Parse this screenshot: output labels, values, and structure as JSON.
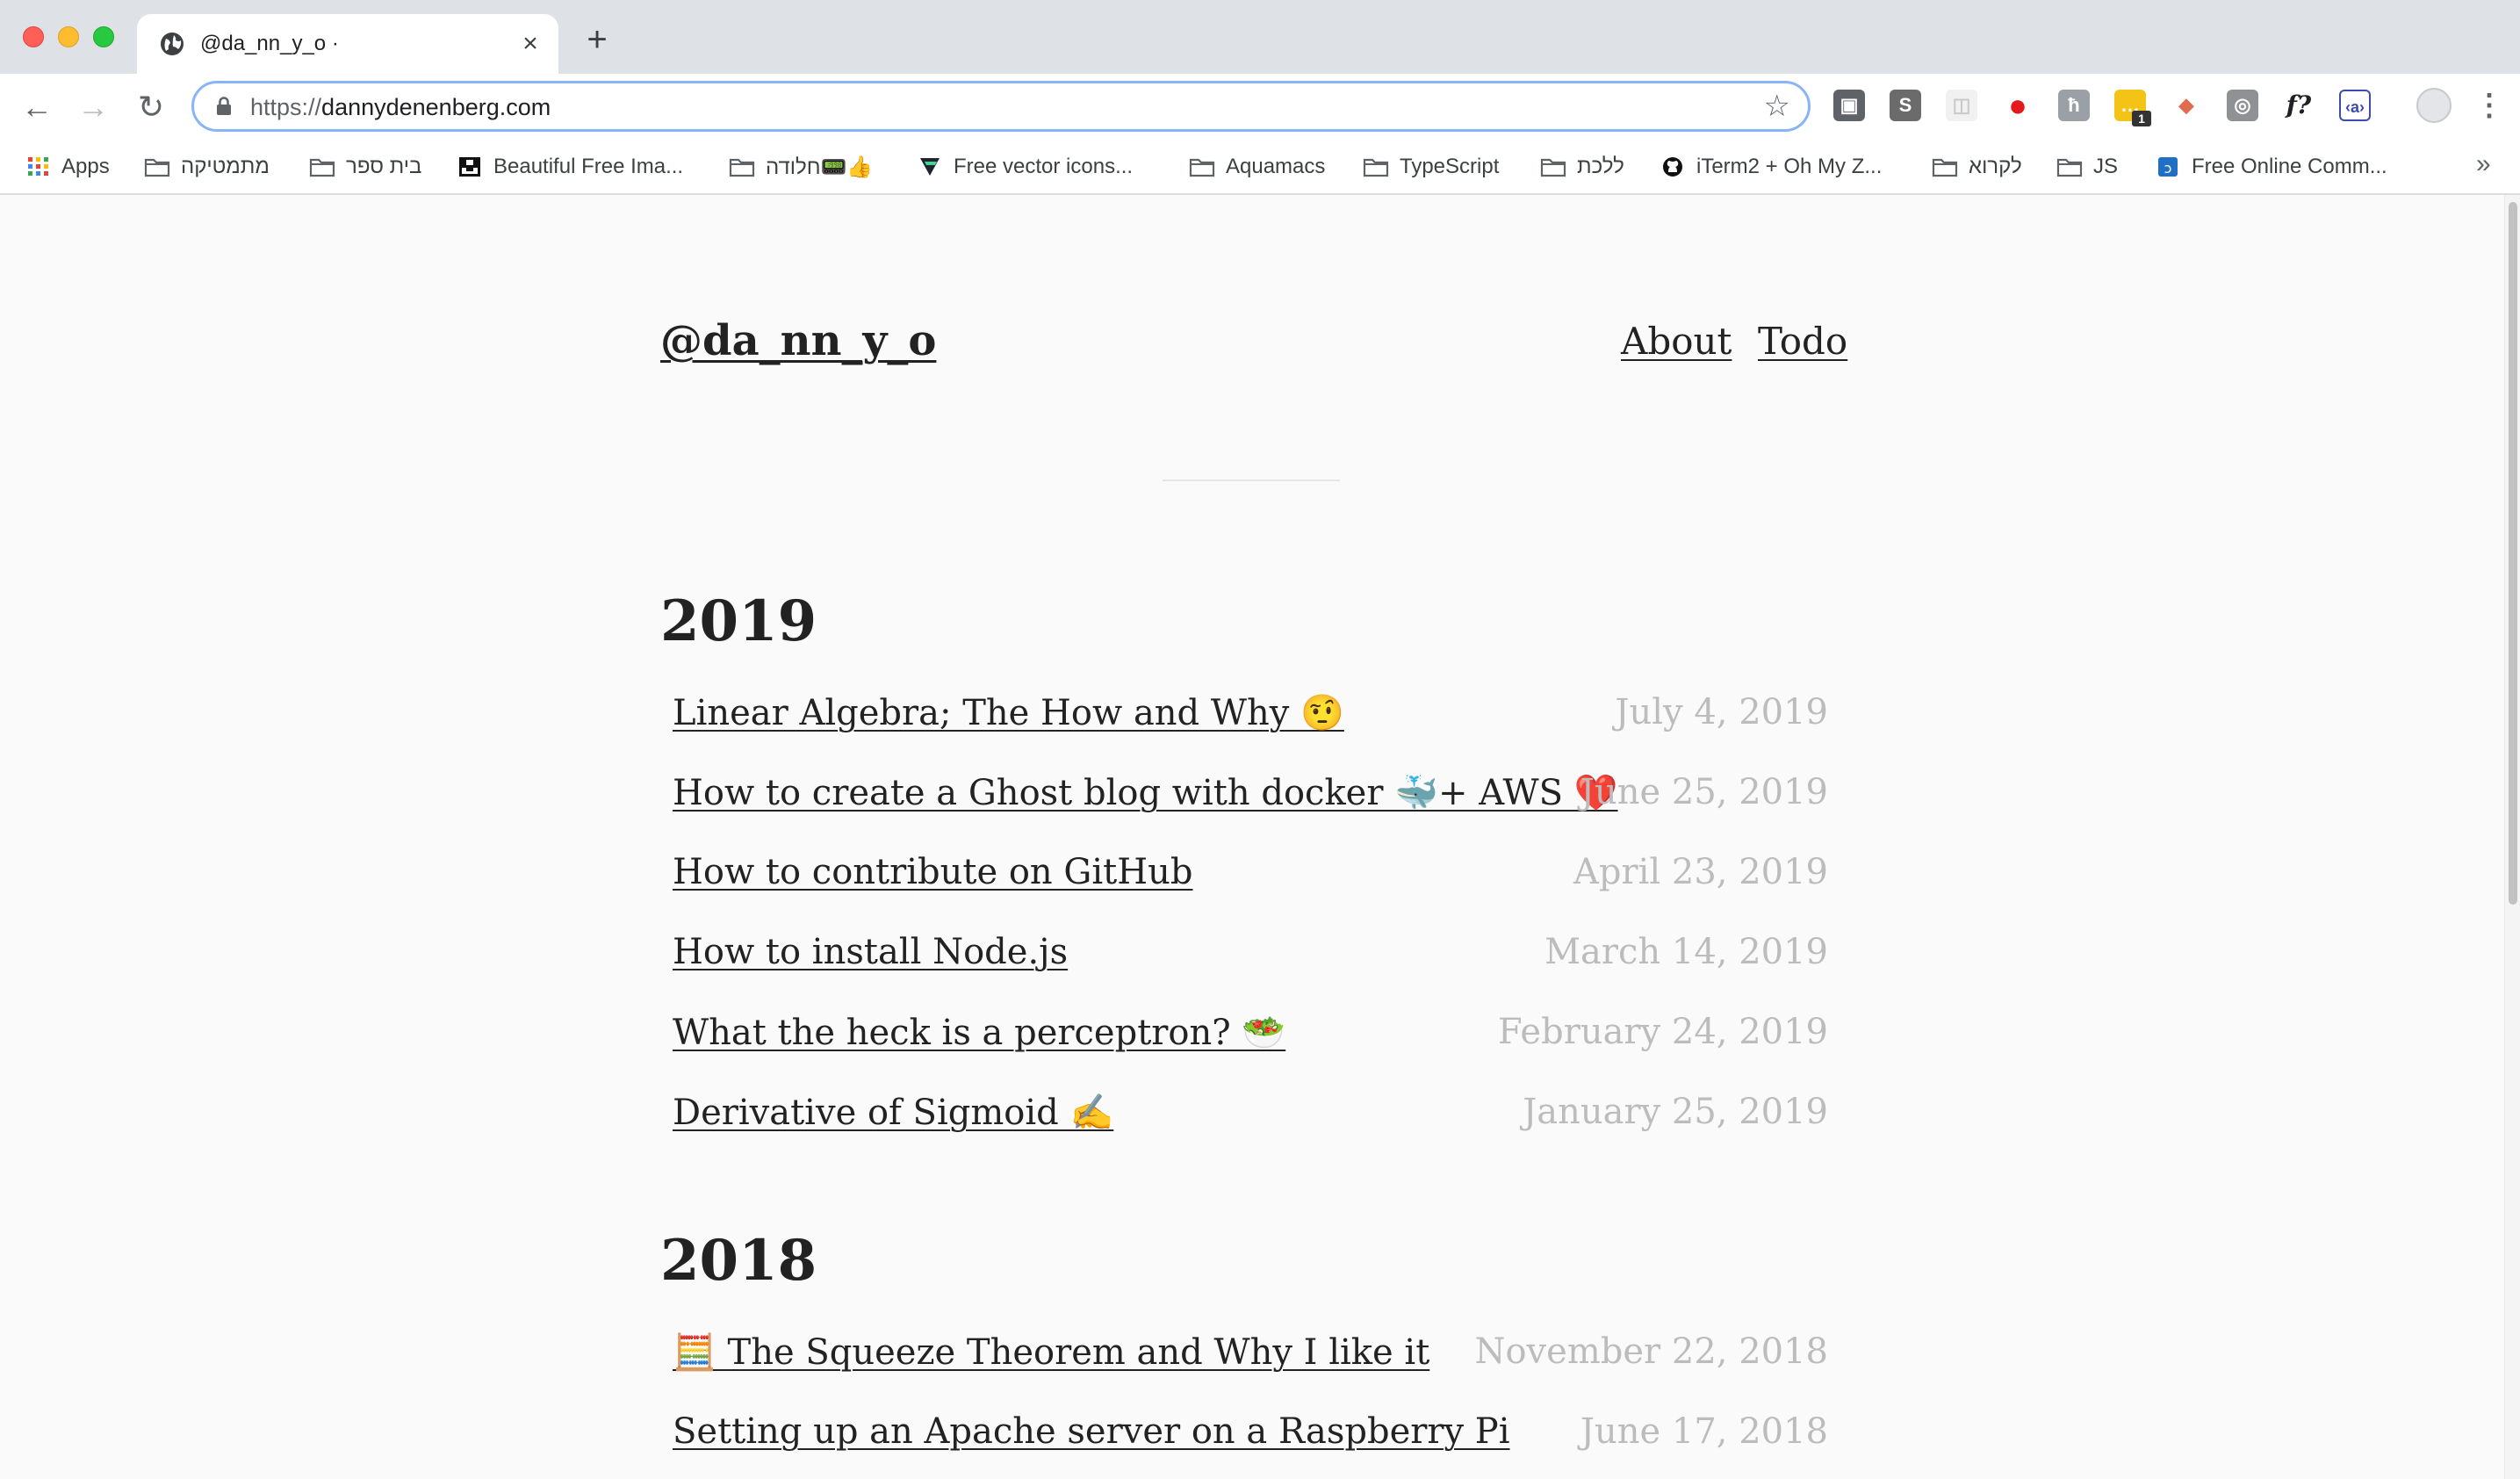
{
  "browser": {
    "tab": {
      "title": "@da_nn_y_o ·",
      "close_glyph": "×"
    },
    "new_tab_glyph": "+",
    "nav": {
      "back_glyph": "←",
      "forward_glyph": "→",
      "reload_glyph": "↻"
    },
    "url": {
      "scheme": "https://",
      "host": "dannydenenberg.com"
    },
    "star_glyph": "☆",
    "menu_glyph": "⋮",
    "extensions": [
      {
        "name": "ext-camera-icon",
        "glyph": "▣",
        "color": "#5f6368"
      },
      {
        "name": "ext-s-icon",
        "glyph": "S",
        "color": "#6b6b6b"
      },
      {
        "name": "ext-grid-icon",
        "glyph": "◫",
        "color": "#e8e8e8"
      },
      {
        "name": "ext-adblock-icon",
        "glyph": "●",
        "color": "#e5181a"
      },
      {
        "name": "ext-h-icon",
        "glyph": "ħ",
        "color": "#9aa0a6"
      },
      {
        "name": "ext-messages-icon",
        "glyph": "…",
        "color": "#f3c316",
        "badge": "1"
      },
      {
        "name": "ext-diamond-icon",
        "glyph": "◆",
        "color": "#e06c4f"
      },
      {
        "name": "ext-square-icon",
        "glyph": "◎",
        "color": "#8f9194"
      },
      {
        "name": "ext-function-icon",
        "glyph": "f?",
        "color": "#ffffff"
      },
      {
        "name": "ext-code-icon",
        "glyph": "‹a›",
        "color": "#ffffff"
      }
    ],
    "more_bookmarks_glyph": "»"
  },
  "bookmarks": [
    {
      "label": "Apps",
      "icon": "apps-grid-icon"
    },
    {
      "label": "מתמטיקה",
      "icon": "folder-icon"
    },
    {
      "label": "בית ספר",
      "icon": "folder-icon"
    },
    {
      "label": "Beautiful Free Ima...",
      "icon": "unsplash-icon"
    },
    {
      "label": "חלודה📟👍",
      "icon": "folder-icon"
    },
    {
      "label": "Free vector icons...",
      "icon": "flaticon-icon"
    },
    {
      "label": "Aquamacs",
      "icon": "folder-icon"
    },
    {
      "label": "TypeScript",
      "icon": "folder-icon"
    },
    {
      "label": "ללכת",
      "icon": "folder-icon"
    },
    {
      "label": "iTerm2 + Oh My Z...",
      "icon": "github-icon"
    },
    {
      "label": "לקרוא",
      "icon": "folder-icon"
    },
    {
      "label": "JS",
      "icon": "folder-icon"
    },
    {
      "label": "Free Online Comm...",
      "icon": "commons-icon"
    }
  ],
  "site": {
    "title": "@da_nn_y_o",
    "nav": {
      "about": "About",
      "todo": "Todo"
    }
  },
  "sections": [
    {
      "year": "2019",
      "posts": [
        {
          "title": "Linear Algebra; The How and Why 🤨",
          "date": "July 4, 2019"
        },
        {
          "title": "How to create a Ghost blog with docker 🐳+ AWS ❤️",
          "date": "June 25, 2019"
        },
        {
          "title": "How to contribute on GitHub",
          "date": "April 23, 2019"
        },
        {
          "title": "How to install Node.js",
          "date": "March 14, 2019"
        },
        {
          "title": "What the heck is a perceptron? 🥗",
          "date": "February 24, 2019"
        },
        {
          "title": "Derivative of Sigmoid ✍️",
          "date": "January 25, 2019"
        }
      ]
    },
    {
      "year": "2018",
      "posts": [
        {
          "title": "🧮 The Squeeze Theorem and Why I like it",
          "date": "November 22, 2018"
        },
        {
          "title": "Setting up an Apache server on a Raspberry Pi",
          "date": "June 17, 2018"
        }
      ]
    }
  ]
}
